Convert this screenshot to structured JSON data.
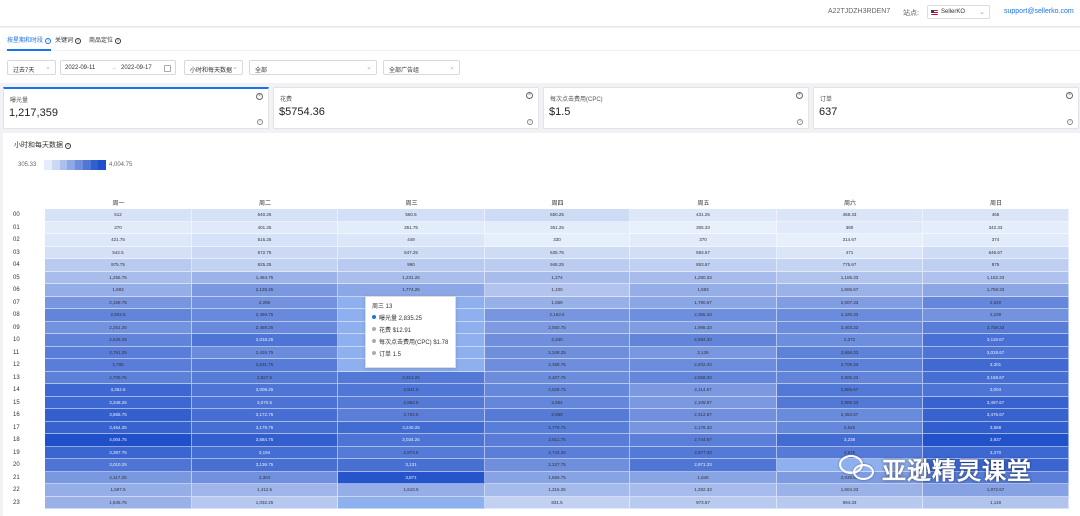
{
  "topbar": {
    "account_id": "A22TJDZH3RDEN7",
    "site_label": "站点:",
    "site_value": "SellerKO",
    "email": "support@sellerko.com"
  },
  "tabs": [
    {
      "label": "按星期和时段",
      "active": true
    },
    {
      "label": "关键词",
      "active": false
    },
    {
      "label": "商品定位",
      "active": false
    }
  ],
  "filters": {
    "range": "过去7天",
    "start_date": "2022-09-11",
    "end_date": "2022-09-17",
    "granularity": "小时和每天数据",
    "metric": "全部",
    "campaign": "全部广告组"
  },
  "kpis": [
    {
      "label": "曝光量",
      "value": "1,217,359"
    },
    {
      "label": "花费",
      "value": "$5754.36"
    },
    {
      "label": "每次点击费用(CPC)",
      "value": "$1.5"
    },
    {
      "label": "订单",
      "value": "637"
    }
  ],
  "panel": {
    "title": "小时和每天数据",
    "legend_min": "305.33",
    "legend_max": "4,004.75"
  },
  "colors": {
    "accent": "#1a73e8",
    "heat_low": "#e8f0fc",
    "heat_high": "#1f4fc9"
  },
  "chart_data": {
    "type": "heatmap",
    "columns": [
      "周一",
      "周二",
      "周三",
      "周四",
      "周五",
      "周六",
      "周日"
    ],
    "rows": [
      "00",
      "01",
      "02",
      "03",
      "04",
      "05",
      "06",
      "07",
      "08",
      "09",
      "10",
      "11",
      "12",
      "13",
      "14",
      "15",
      "16",
      "17",
      "18",
      "19",
      "20",
      "21",
      "22",
      "23"
    ],
    "min": 305.33,
    "max": 4004.75,
    "values": [
      [
        "512",
        "540.25",
        "560.5",
        "650.25",
        "431.25",
        "468.33",
        "465"
      ],
      [
        "370",
        "401.25",
        "351.75",
        "351.25",
        "305.33",
        "380",
        "342.33"
      ],
      [
        "421.75",
        "516.25",
        "449",
        "330",
        "370",
        "314.67",
        "374"
      ],
      [
        "542.5",
        "672.75",
        "647.25",
        "635.75",
        "593.67",
        "471",
        "646.67"
      ],
      [
        "975.75",
        "825.25",
        "990",
        "948.25",
        "853.67",
        "775.67",
        "875"
      ],
      [
        "1,265.75",
        "1,484.75",
        "1,231.25",
        "1,274",
        "1,280.33",
        "1,106.33",
        "1,152.33"
      ],
      [
        "1,593",
        "2,128.25",
        "1,774.25",
        "1,100",
        "1,593",
        "1,506.67",
        "1,758.33"
      ],
      [
        "2,168.75",
        "2,286",
        "",
        "1,559",
        "1,790.67",
        "2,007.33",
        "2,540"
      ],
      [
        "2,603.5",
        "2,469.75",
        "",
        "2,163.5",
        "2,355.33",
        "2,425.33",
        "2,239"
      ],
      [
        "2,251.25",
        "2,469.25",
        "",
        "2,050.75",
        "1,995.33",
        "2,403.33",
        "2,758.33"
      ],
      [
        "2,626.25",
        "3,018.25",
        "",
        "2,340",
        "2,592.33",
        "2,372",
        "3,119.67"
      ],
      [
        "2,791.25",
        "2,426.75",
        "",
        "2,348.25",
        "2,136",
        "2,668.33",
        "3,019.67"
      ],
      [
        "2,785",
        "2,831.75",
        "",
        "2,358.75",
        "2,402.33",
        "2,705.33",
        "3,301"
      ],
      [
        "2,709.75",
        "2,827.5",
        "2,913.25",
        "2,407.75",
        "2,559.33",
        "2,605.33",
        "3,158.67"
      ],
      [
        "3,352.5",
        "3,008.25",
        "2,941.5",
        "2,528.75",
        "2,114.67",
        "2,906.67",
        "3,004"
      ],
      [
        "3,348.25",
        "3,070.5",
        "2,882.5",
        "2,554",
        "2,109.67",
        "2,905.33",
        "3,497.67"
      ],
      [
        "3,555.75",
        "3,172.75",
        "2,752.5",
        "2,859",
        "2,312.67",
        "2,452.67",
        "3,475.67"
      ],
      [
        "3,464.25",
        "3,179.75",
        "3,240.25",
        "2,779.75",
        "2,178.33",
        "2,522",
        "3,568"
      ],
      [
        "4,004.75",
        "3,584.75",
        "3,034.25",
        "2,811.75",
        "2,744.67",
        "3,238",
        "3,937"
      ],
      [
        "3,397.75",
        "3,194",
        "2,873.5",
        "2,743.25",
        "2,877.33",
        "2,875",
        "3,370"
      ],
      [
        "3,010.25",
        "3,136.75",
        "3,131",
        "2,337.75",
        "2,971.33",
        "",
        "3,402.33"
      ],
      [
        "2,117.25",
        "2,304",
        "3,871",
        "1,869.75",
        "1,845",
        "2,038.67",
        "2,791"
      ],
      [
        "1,597.5",
        "1,412.5",
        "1,610.5",
        "1,315.25",
        "1,282.33",
        "1,504.33",
        "1,872.67"
      ],
      [
        "1,545.75",
        "1,032.25",
        "",
        "831.5",
        "973.67",
        "994.33",
        "1,119"
      ]
    ]
  },
  "tooltip": {
    "title": "周三 13",
    "lines": [
      {
        "text": "曝光量 2,835.25",
        "color": "#1a73e8"
      },
      {
        "text": "花费 $12.91",
        "color": "#aaaaaa"
      },
      {
        "text": "每次点击费用(CPC) $1.78",
        "color": "#aaaaaa"
      },
      {
        "text": "订单 1.5",
        "color": "#aaaaaa"
      }
    ]
  },
  "watermark": {
    "text": "亚逊精灵课堂"
  }
}
